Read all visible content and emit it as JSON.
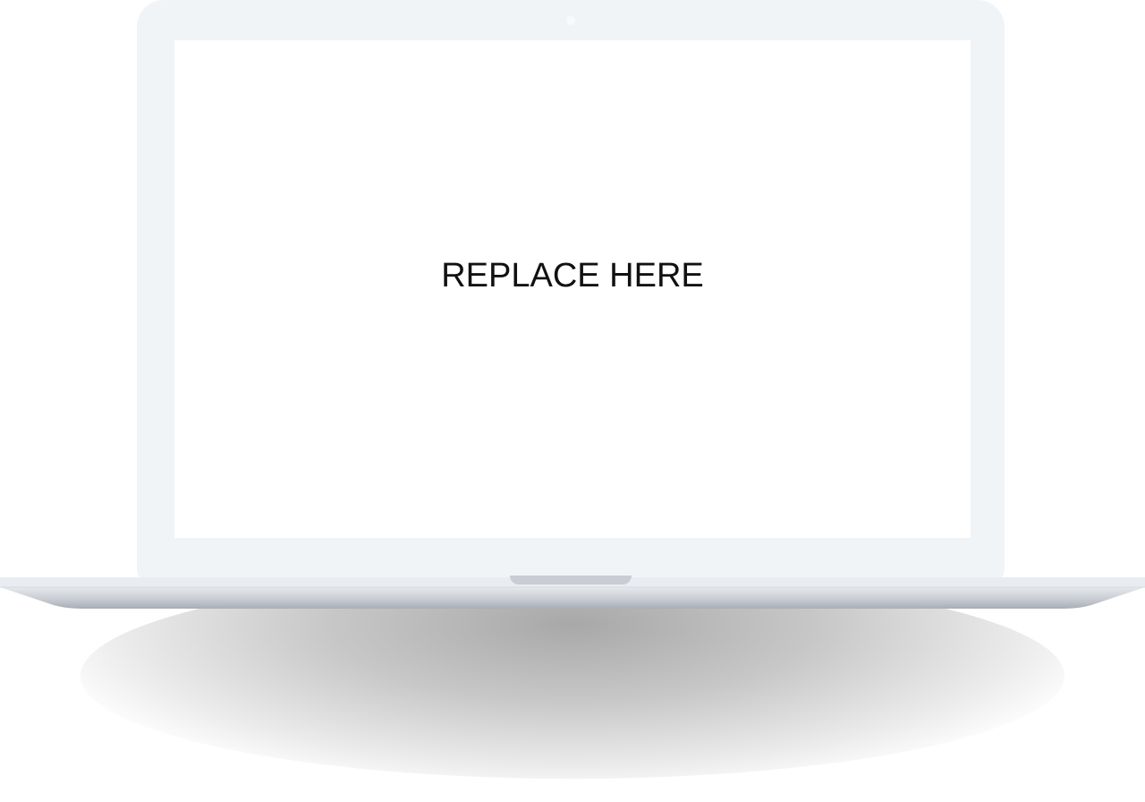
{
  "screen": {
    "placeholder_text": "REPLACE HERE"
  },
  "colors": {
    "lid": "#f1f4f7",
    "screen": "#ffffff",
    "base_top": "#e9ecf0",
    "base_bottom": "#a9adb6",
    "hinge": "#c9cdd3",
    "text": "#111111"
  }
}
